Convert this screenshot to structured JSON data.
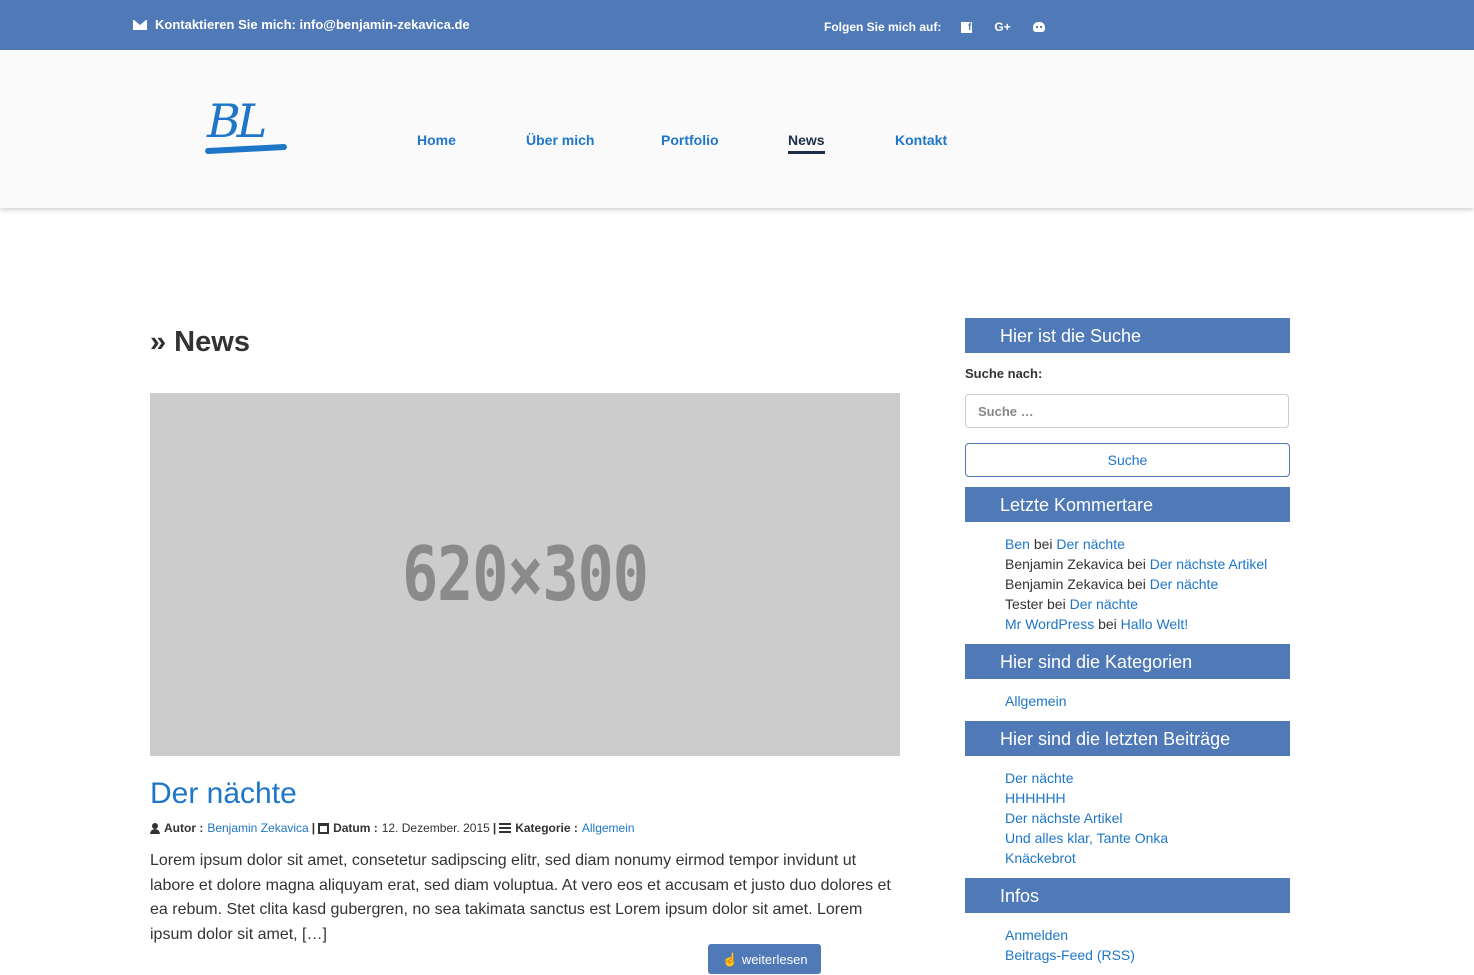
{
  "topbar": {
    "contact_text": "Kontaktieren Sie mich: info@benjamin-zekavica.de",
    "follow_text": "Folgen Sie mich auf:",
    "social": [
      "facebook-icon",
      "google-plus-icon",
      "github-icon"
    ]
  },
  "header": {
    "logo_text": "BL",
    "nav": [
      {
        "label": "Home",
        "active": false
      },
      {
        "label": "Über mich",
        "active": false
      },
      {
        "label": "Portfolio",
        "active": false
      },
      {
        "label": "News",
        "active": true
      },
      {
        "label": "Kontakt",
        "active": false
      }
    ]
  },
  "main": {
    "page_title": "» News",
    "post": {
      "image_placeholder": "620×300",
      "title": "Der nächte",
      "author_label": "Autor :",
      "author": "Benjamin Zekavica",
      "date_label": "Datum :",
      "date": "12. Dezember. 2015",
      "category_label": "Kategorie :",
      "category": "Allgemein",
      "separator": "|",
      "excerpt": "Lorem ipsum dolor sit amet, consetetur sadipscing elitr, sed diam nonumy eirmod tempor invidunt ut labore et dolore magna aliquyam erat, sed diam voluptua. At vero eos et accusam et justo duo dolores et ea rebum. Stet clita kasd gubergren, no sea takimata sanctus est Lorem ipsum dolor sit amet. Lorem ipsum dolor sit amet, […]",
      "more_label": "weiterlesen"
    }
  },
  "sidebar": {
    "search": {
      "heading": "Hier ist die Suche",
      "label": "Suche nach:",
      "placeholder": "Suche …",
      "button": "Suche"
    },
    "comments": {
      "heading": "Letzte Kommertare",
      "connector": "bei",
      "items": [
        {
          "author": "Ben",
          "author_link": true,
          "post": "Der nächte"
        },
        {
          "author": "Benjamin Zekavica",
          "author_link": false,
          "post": "Der nächste Artikel"
        },
        {
          "author": "Benjamin Zekavica",
          "author_link": false,
          "post": "Der nächte"
        },
        {
          "author": "Tester",
          "author_link": false,
          "post": "Der nächte"
        },
        {
          "author": "Mr WordPress",
          "author_link": true,
          "post": "Hallo Welt!"
        }
      ]
    },
    "categories": {
      "heading": "Hier sind die Kategorien",
      "items": [
        "Allgemein"
      ]
    },
    "recent_posts": {
      "heading": "Hier sind die letzten Beiträge",
      "items": [
        "Der nächte",
        "HHHHHH",
        "Der nächste Artikel",
        "Und alles klar, Tante Onka",
        "Knäckebrot"
      ]
    },
    "infos": {
      "heading": "Infos",
      "items": [
        "Anmelden",
        "Beitrags-Feed (RSS)"
      ]
    }
  },
  "colors": {
    "brand": "#5079b7",
    "link": "#1e76c8",
    "active_nav": "#1c2e4a"
  }
}
